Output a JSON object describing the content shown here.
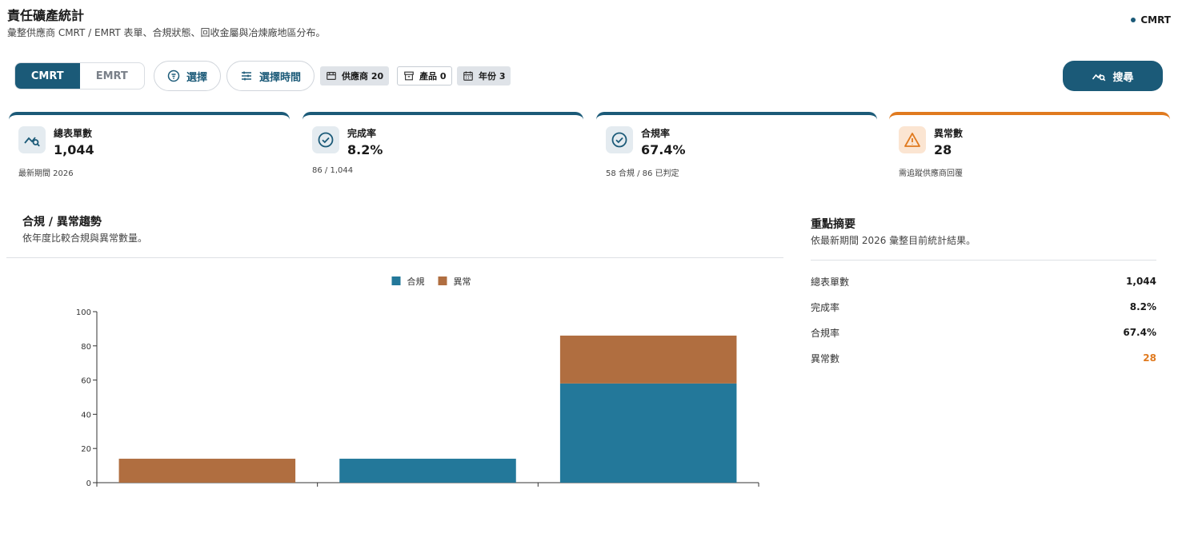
{
  "header": {
    "title": "責任礦產統計",
    "subtitle": "彙整供應商 CMRT / EMRT 表單、合規狀態、回收金屬與冶煉廠地區分布。",
    "badge": "CMRT"
  },
  "toolbar": {
    "tabs": [
      "CMRT",
      "EMRT"
    ],
    "active_tab": "CMRT",
    "select_label": "選擇",
    "select_time_label": "選擇時間",
    "chips": {
      "supplier": "供應商 20",
      "product": "產品 0",
      "year": "年份 3"
    },
    "search_label": "搜尋"
  },
  "kpis": [
    {
      "label": "總表單數",
      "value": "1,044",
      "foot": "最新期間 2026",
      "icon": "chart-search-icon"
    },
    {
      "label": "完成率",
      "value": "8.2%",
      "foot": "86 / 1,044",
      "icon": "check-circle-icon"
    },
    {
      "label": "合規率",
      "value": "67.4%",
      "foot": "58 合規 / 86 已判定",
      "icon": "check-circle-icon"
    },
    {
      "label": "異常數",
      "value": "28",
      "foot": "需追蹤供應商回覆",
      "icon": "warning-icon"
    }
  ],
  "chart_panel": {
    "title": "合規 / 異常趨勢",
    "subtitle": "依年度比較合規與異常數量。"
  },
  "chart_data": {
    "type": "bar",
    "stacked": true,
    "categories": [
      "",
      "",
      ""
    ],
    "series": [
      {
        "name": "合規",
        "color": "#23789a",
        "values": [
          0,
          14,
          58
        ]
      },
      {
        "name": "異常",
        "color": "#b06e40",
        "values": [
          14,
          0,
          28
        ]
      }
    ],
    "ylim": [
      0,
      100
    ],
    "yticks": [
      0,
      20,
      40,
      60,
      80,
      100
    ],
    "legend": "top-center",
    "grid": false
  },
  "summary": {
    "title": "重點摘要",
    "subtitle": "依最新期間 2026 彙整目前統計結果。",
    "rows": [
      {
        "label": "總表單數",
        "value": "1,044"
      },
      {
        "label": "完成率",
        "value": "8.2%"
      },
      {
        "label": "合規率",
        "value": "67.4%"
      },
      {
        "label": "異常數",
        "value": "28"
      }
    ]
  },
  "colors": {
    "primary": "#1b5a78",
    "warning": "#e07a1f",
    "compliant": "#23789a",
    "abnormal": "#b06e40"
  }
}
